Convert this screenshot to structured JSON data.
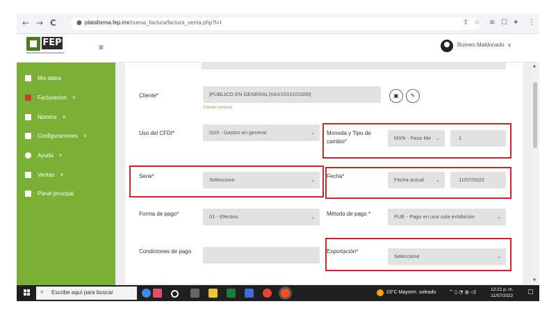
{
  "browser": {
    "back": "←",
    "forward": "→",
    "reload": "C",
    "url_host": "plataforma.fep.mx",
    "url_path": "/nueva_factura/factura_venta.php?t=I",
    "icons": [
      "share-icon",
      "star-icon",
      "reading-list-icon",
      "tab-icon",
      "extensions-icon",
      "kebab-menu-icon"
    ]
  },
  "header": {
    "logo_text": "FEP",
    "menu_icon": "≡",
    "user_name": "Romeo Maldonado",
    "user_caret": "∨"
  },
  "sidebar": {
    "items": [
      {
        "label": "Mis datos",
        "has_submenu": false
      },
      {
        "label": "Facturacion",
        "has_submenu": true
      },
      {
        "label": "Nómina",
        "has_submenu": true
      },
      {
        "label": "Configuraciones",
        "has_submenu": true
      },
      {
        "label": "Ayuda",
        "has_submenu": true
      },
      {
        "label": "Ventas",
        "has_submenu": true
      },
      {
        "label": "Panel principal",
        "has_submenu": false
      }
    ],
    "chevron": "∨"
  },
  "form": {
    "cliente": {
      "label": "Cliente*",
      "value": "|PUBLICO EN GENERAL|XAXX010101000|",
      "hint": "Cliente correcto"
    },
    "uso_cfdi": {
      "label": "Uso del CFDI*",
      "value": "G03 - Gastos en general"
    },
    "moneda": {
      "label": "Moneda y Tipo de cambio*",
      "value": "MXN - Peso Me",
      "rate": "1"
    },
    "serie": {
      "label": "Serie*",
      "value": "Seleccione"
    },
    "fecha": {
      "label": "Fecha*",
      "value": "Fecha actual",
      "date": "11/07/2022"
    },
    "forma_pago": {
      "label": "Forma de pago*",
      "value": "01 - Efectivo"
    },
    "metodo_pago": {
      "label": "Método de pago *",
      "value": "PUE - Pago en una sola exhibición"
    },
    "condiciones": {
      "label": "Condiciones de pago",
      "value": ""
    },
    "exportacion": {
      "label": "Exportación*",
      "value": "Seleccione"
    },
    "select_caret": "⌄"
  },
  "taskbar": {
    "search_placeholder": "Escribe aquí para buscar",
    "weather": "23°C  Mayorm. soleado",
    "time": "12:22 p. m.",
    "date": "11/07/2022",
    "colors": {
      "bar": "#1f1f1f"
    }
  },
  "colors": {
    "sidebar": "#7ab036",
    "highlight": "#d2232a",
    "hint": "#7ab036"
  }
}
